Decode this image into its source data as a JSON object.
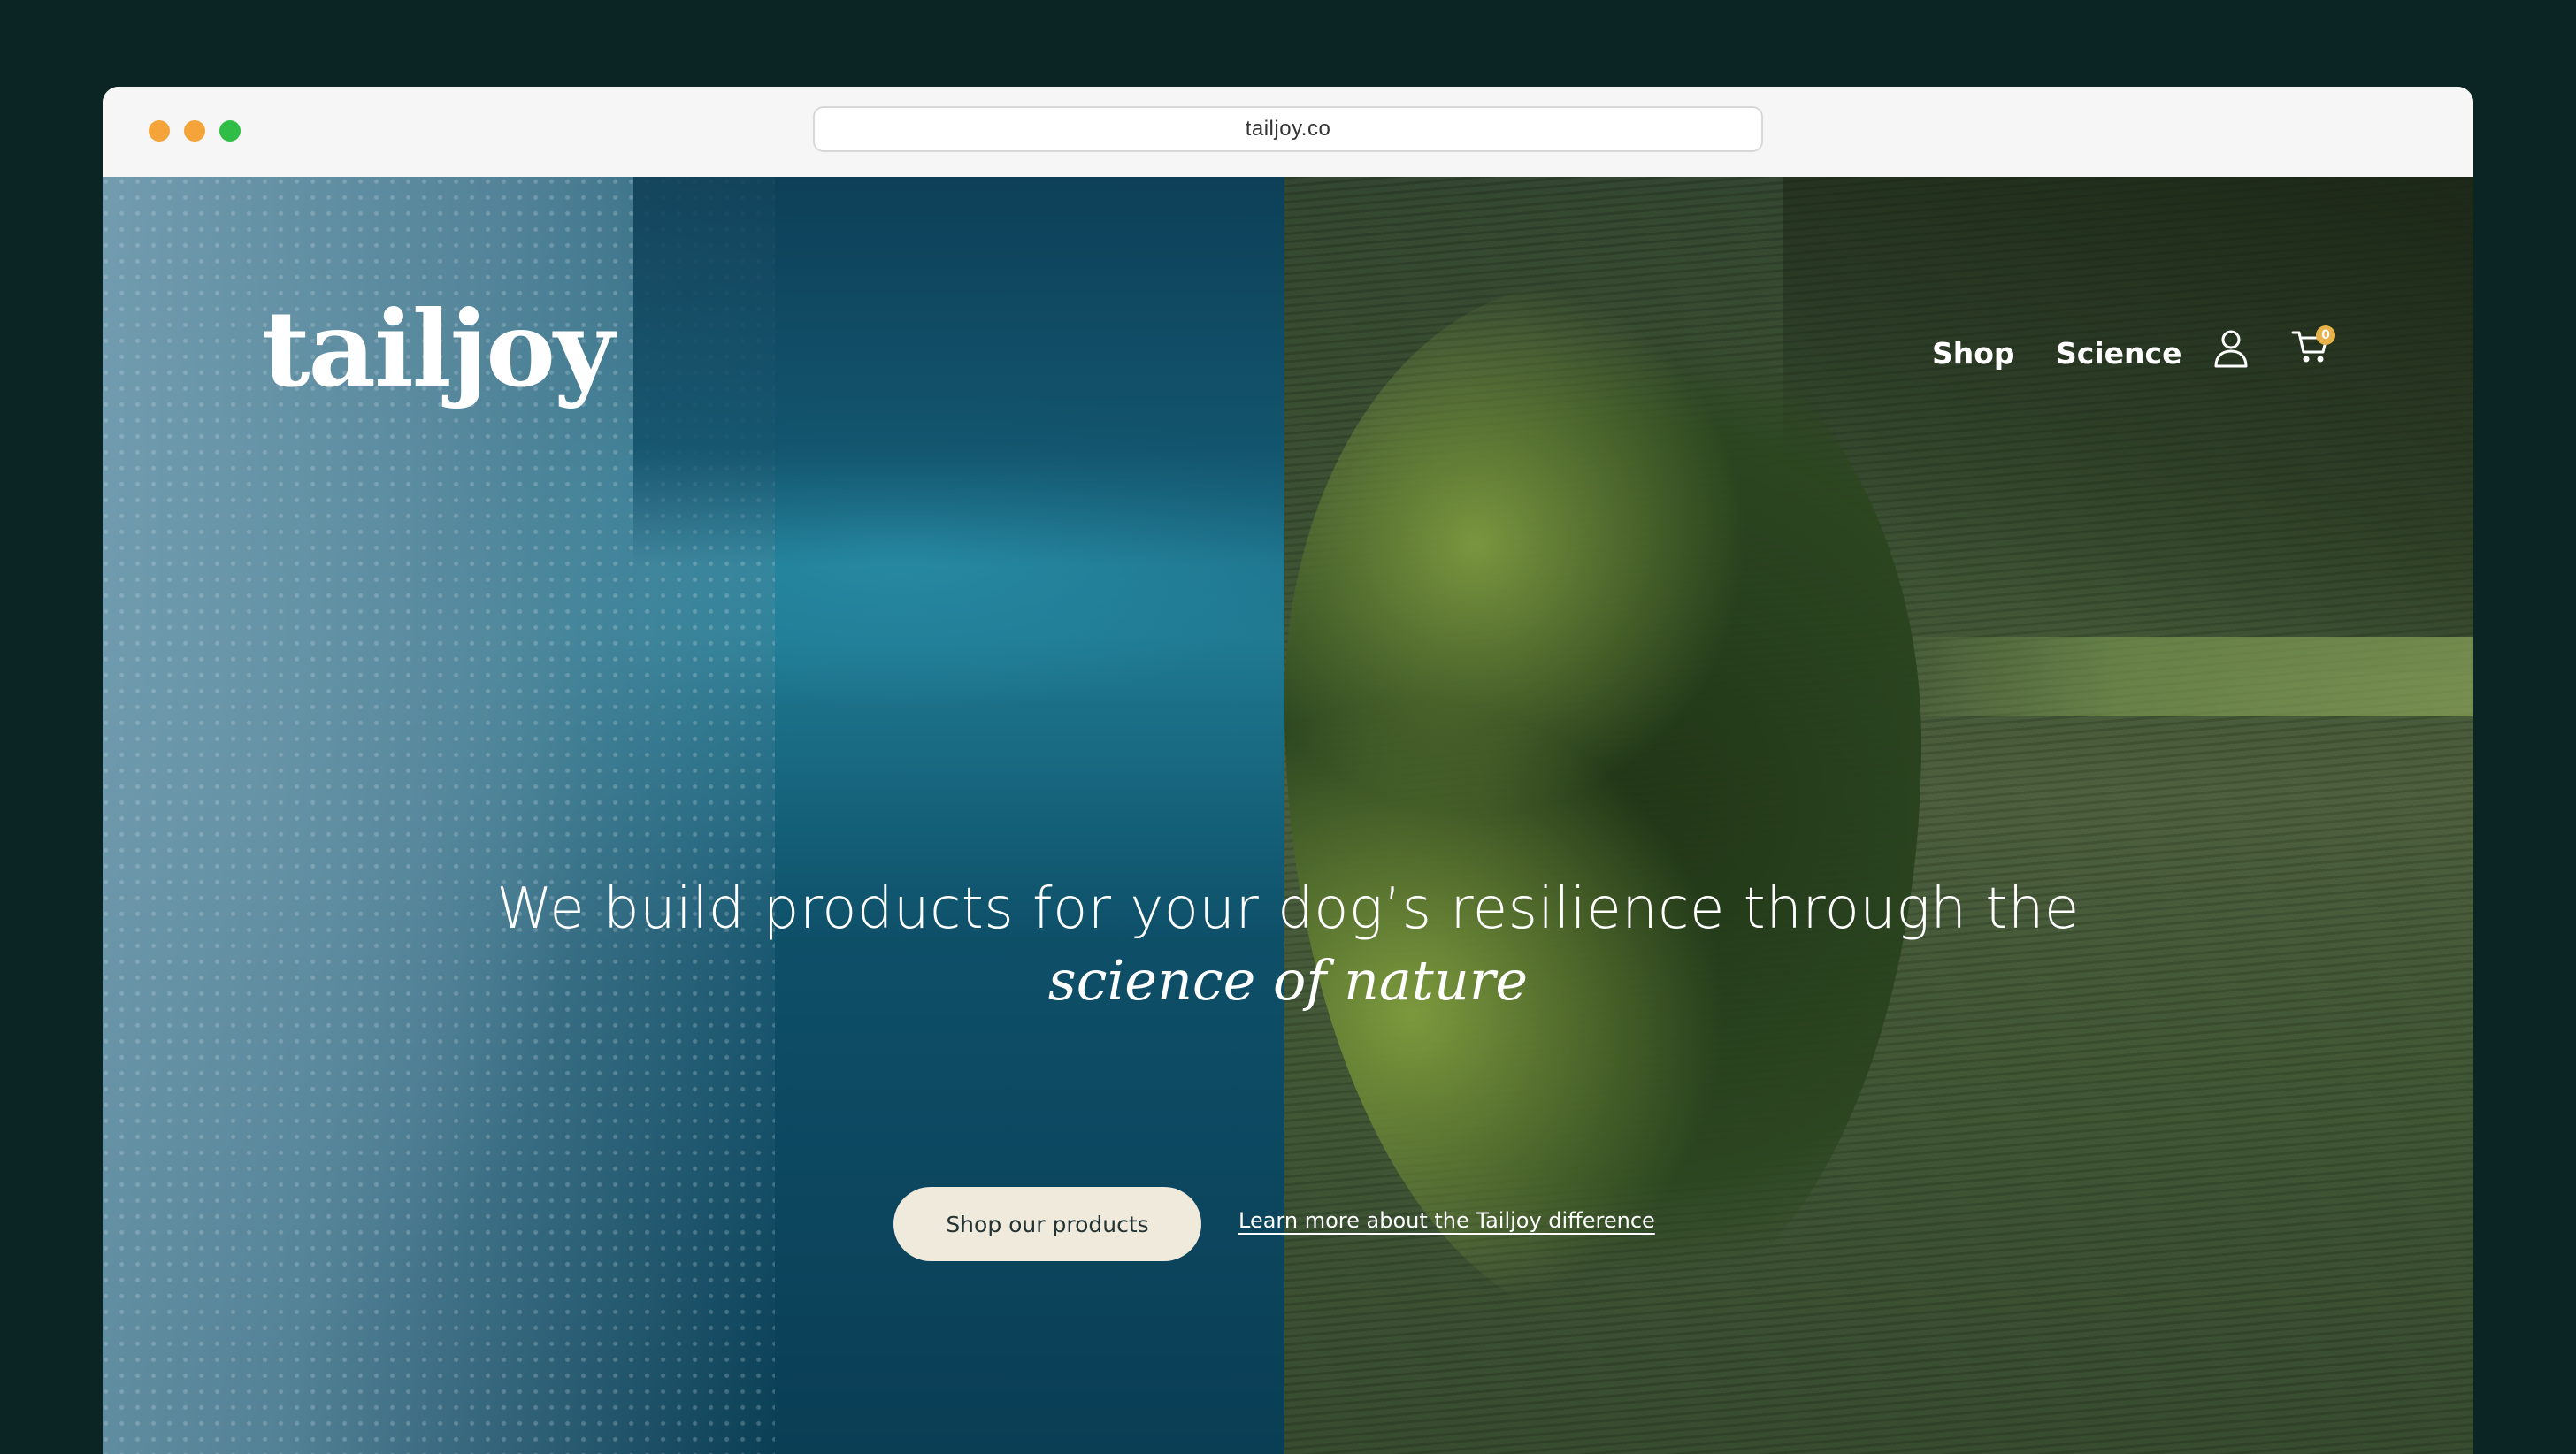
{
  "browser": {
    "url": "tailjoy.co",
    "traffic_lights": {
      "close_color": "#f5a43a",
      "minimize_color": "#f5a43a",
      "zoom_color": "#2fbd45"
    }
  },
  "header": {
    "logo_text": "tailjoy",
    "nav": [
      {
        "label": "Shop"
      },
      {
        "label": "Science"
      }
    ],
    "account_icon": "user-icon",
    "cart_icon": "shopping-cart-icon",
    "cart_count": "0"
  },
  "hero": {
    "headline": "We build products for your dog’s resilience through the",
    "headline_accent": "science of nature",
    "primary_cta": "Shop our products",
    "secondary_cta": "Learn more about the Tailjoy difference"
  },
  "colors": {
    "page_background": "#0b2424",
    "cta_background": "#efeadb",
    "cart_badge": "#e8b24a"
  }
}
